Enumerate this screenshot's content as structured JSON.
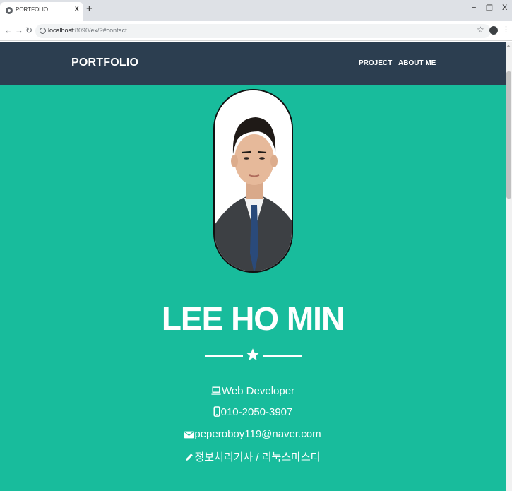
{
  "browser": {
    "tab_title": "PORTFOLIO",
    "tab_close": "x",
    "new_tab": "+",
    "url_host": "localhost",
    "url_rest": ":8090/ex/?#contact",
    "minimize": "−",
    "restore": "❐",
    "close": "X"
  },
  "navbar": {
    "brand": "PORTFOLIO",
    "links": [
      "PROJECT",
      "ABOUT ME"
    ]
  },
  "hero": {
    "name": "LEE HO MIN",
    "info": {
      "role": "Web Developer",
      "phone": "010-2050-3907",
      "email": "peperoboy119@naver.com",
      "certs": "정보처리기사 / 리눅스마스터"
    }
  },
  "colors": {
    "navbar_bg": "#2c3e50",
    "hero_bg": "#18bc9c",
    "text": "#ffffff"
  }
}
